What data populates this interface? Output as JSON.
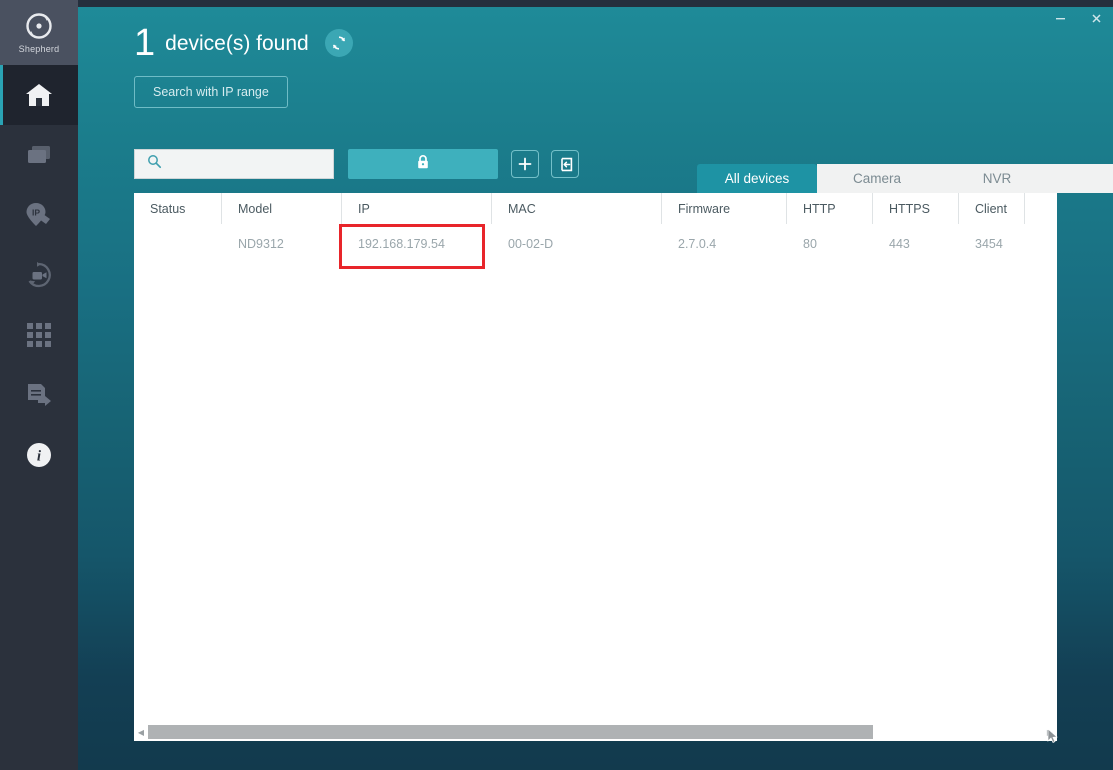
{
  "window": {
    "minimize_label": "minimize-icon",
    "close_label": "close-icon"
  },
  "sidebar": {
    "brand": "Shepherd",
    "items": [
      {
        "id": "home",
        "icon": "home-icon",
        "active": true
      },
      {
        "id": "devices",
        "icon": "layers-icon",
        "active": false
      },
      {
        "id": "ip",
        "icon": "ip-tag-icon",
        "active": false
      },
      {
        "id": "reboot",
        "icon": "camera-refresh-icon",
        "active": false
      },
      {
        "id": "grid",
        "icon": "grid-icon",
        "active": false
      },
      {
        "id": "export",
        "icon": "document-export-icon",
        "active": false
      },
      {
        "id": "about",
        "icon": "info-icon",
        "active": false
      }
    ]
  },
  "header": {
    "count": "1",
    "found_label": "device(s) found",
    "refresh_icon": "refresh-icon",
    "ip_range_button": "Search with IP range"
  },
  "toolbar": {
    "search_placeholder": "",
    "search_value": "",
    "search_icon": "search-icon",
    "password_button_icon": "lock-icon",
    "password_button_label": "",
    "add_button_label": "+",
    "export_button_icon": "export-icon"
  },
  "tabs": {
    "items": [
      {
        "label": "All devices",
        "active": true
      },
      {
        "label": "Camera",
        "active": false
      },
      {
        "label": "NVR",
        "active": false
      }
    ]
  },
  "table": {
    "columns": [
      "Status",
      "Model",
      "IP",
      "MAC",
      "Firmware",
      "HTTP",
      "HTTPS",
      "Client",
      ""
    ],
    "rows": [
      {
        "status": "",
        "model": "ND9312",
        "ip": "192.168.179.54",
        "mac": "00-02-D",
        "firmware": "2.7.0.4",
        "http": "80",
        "https": "443",
        "client": "3454",
        "extra": ""
      }
    ],
    "highlight": {
      "row": 0,
      "column": "ip",
      "color": "#e8252a"
    }
  },
  "scrollbar": {
    "left_arrow": "◀",
    "right_arrow": "▶",
    "thumb_percent": "81"
  },
  "colors": {
    "accent": "#1e93a4",
    "teal_button": "#3eb0bd",
    "sidebar": "#2b313c",
    "brand_bar": "#4a5160",
    "highlight": "#e8252a",
    "panel": "#ffffff"
  }
}
